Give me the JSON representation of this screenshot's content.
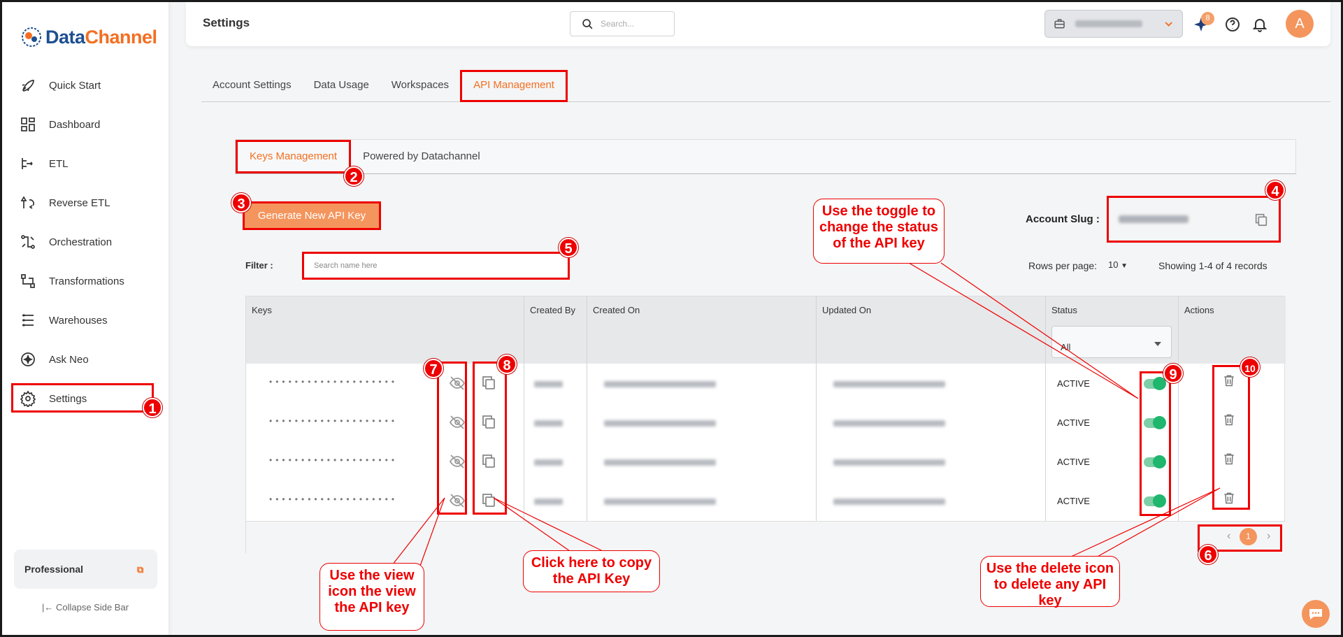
{
  "brand": {
    "name_part1": "Data",
    "name_part2": "Channel"
  },
  "sidebar": {
    "items": [
      {
        "label": "Quick Start",
        "icon": "rocket-icon"
      },
      {
        "label": "Dashboard",
        "icon": "dashboard-icon"
      },
      {
        "label": "ETL",
        "icon": "etl-icon"
      },
      {
        "label": "Reverse ETL",
        "icon": "reverse-etl-icon"
      },
      {
        "label": "Orchestration",
        "icon": "orchestration-icon"
      },
      {
        "label": "Transformations",
        "icon": "transformations-icon"
      },
      {
        "label": "Warehouses",
        "icon": "warehouses-icon"
      },
      {
        "label": "Ask Neo",
        "icon": "ask-neo-icon"
      },
      {
        "label": "Settings",
        "icon": "gear-icon"
      }
    ],
    "plan": "Professional",
    "collapse": "Collapse Side Bar"
  },
  "header": {
    "title": "Settings",
    "search_placeholder": "Search...",
    "notification_count": "8",
    "avatar_initial": "A"
  },
  "tabs": [
    "Account Settings",
    "Data Usage",
    "Workspaces",
    "API Management"
  ],
  "subtabs": [
    "Keys Management",
    "Powered by Datachannel"
  ],
  "generate_button": "Generate New API Key",
  "slug": {
    "label": "Account Slug :"
  },
  "filter": {
    "label": "Filter :",
    "placeholder": "Search name here"
  },
  "pagination": {
    "rows_label": "Rows per page:",
    "rows_value": "10",
    "showing": "Showing 1-4 of 4 records",
    "current_page": "1"
  },
  "table": {
    "headers": [
      "Keys",
      "Created By",
      "Created On",
      "Updated On",
      "Status",
      "Actions"
    ],
    "status_filter": "All",
    "rows": [
      {
        "key": "••••••••••••••••••••",
        "status": "ACTIVE"
      },
      {
        "key": "••••••••••••••••••••",
        "status": "ACTIVE"
      },
      {
        "key": "••••••••••••••••••••",
        "status": "ACTIVE"
      },
      {
        "key": "••••••••••••••••••••",
        "status": "ACTIVE"
      }
    ]
  },
  "annotations": {
    "numbers": [
      "1",
      "2",
      "3",
      "4",
      "5",
      "6",
      "7",
      "8",
      "9",
      "10"
    ],
    "callout_toggle": "Use the toggle to change the status of the API key",
    "callout_view": "Use the view icon the view the API key",
    "callout_copy": "Click here to copy the API Key",
    "callout_delete": "Use the delete icon to delete any API key"
  },
  "colors": {
    "accent": "#f36f21",
    "annotation": "#e00000",
    "toggle_on": "#1fb66d"
  }
}
